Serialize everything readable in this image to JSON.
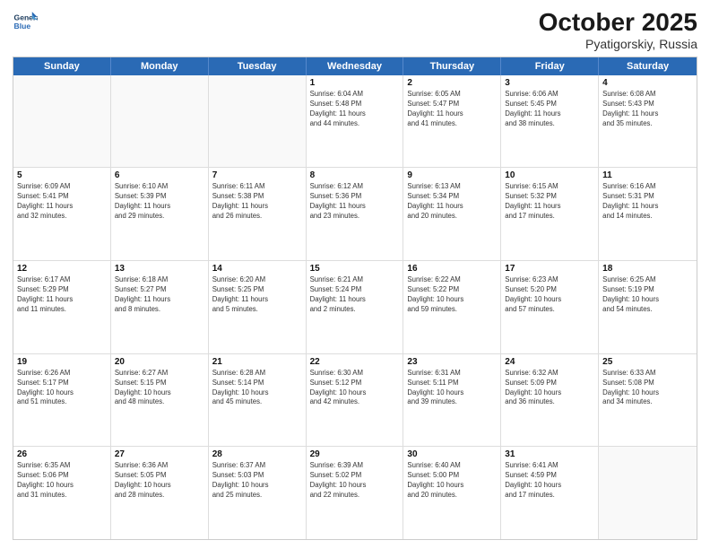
{
  "header": {
    "logo_line1": "General",
    "logo_line2": "Blue",
    "month": "October 2025",
    "location": "Pyatigorskiy, Russia"
  },
  "days_of_week": [
    "Sunday",
    "Monday",
    "Tuesday",
    "Wednesday",
    "Thursday",
    "Friday",
    "Saturday"
  ],
  "weeks": [
    [
      {
        "day": "",
        "info": ""
      },
      {
        "day": "",
        "info": ""
      },
      {
        "day": "",
        "info": ""
      },
      {
        "day": "1",
        "info": "Sunrise: 6:04 AM\nSunset: 5:48 PM\nDaylight: 11 hours\nand 44 minutes."
      },
      {
        "day": "2",
        "info": "Sunrise: 6:05 AM\nSunset: 5:47 PM\nDaylight: 11 hours\nand 41 minutes."
      },
      {
        "day": "3",
        "info": "Sunrise: 6:06 AM\nSunset: 5:45 PM\nDaylight: 11 hours\nand 38 minutes."
      },
      {
        "day": "4",
        "info": "Sunrise: 6:08 AM\nSunset: 5:43 PM\nDaylight: 11 hours\nand 35 minutes."
      }
    ],
    [
      {
        "day": "5",
        "info": "Sunrise: 6:09 AM\nSunset: 5:41 PM\nDaylight: 11 hours\nand 32 minutes."
      },
      {
        "day": "6",
        "info": "Sunrise: 6:10 AM\nSunset: 5:39 PM\nDaylight: 11 hours\nand 29 minutes."
      },
      {
        "day": "7",
        "info": "Sunrise: 6:11 AM\nSunset: 5:38 PM\nDaylight: 11 hours\nand 26 minutes."
      },
      {
        "day": "8",
        "info": "Sunrise: 6:12 AM\nSunset: 5:36 PM\nDaylight: 11 hours\nand 23 minutes."
      },
      {
        "day": "9",
        "info": "Sunrise: 6:13 AM\nSunset: 5:34 PM\nDaylight: 11 hours\nand 20 minutes."
      },
      {
        "day": "10",
        "info": "Sunrise: 6:15 AM\nSunset: 5:32 PM\nDaylight: 11 hours\nand 17 minutes."
      },
      {
        "day": "11",
        "info": "Sunrise: 6:16 AM\nSunset: 5:31 PM\nDaylight: 11 hours\nand 14 minutes."
      }
    ],
    [
      {
        "day": "12",
        "info": "Sunrise: 6:17 AM\nSunset: 5:29 PM\nDaylight: 11 hours\nand 11 minutes."
      },
      {
        "day": "13",
        "info": "Sunrise: 6:18 AM\nSunset: 5:27 PM\nDaylight: 11 hours\nand 8 minutes."
      },
      {
        "day": "14",
        "info": "Sunrise: 6:20 AM\nSunset: 5:25 PM\nDaylight: 11 hours\nand 5 minutes."
      },
      {
        "day": "15",
        "info": "Sunrise: 6:21 AM\nSunset: 5:24 PM\nDaylight: 11 hours\nand 2 minutes."
      },
      {
        "day": "16",
        "info": "Sunrise: 6:22 AM\nSunset: 5:22 PM\nDaylight: 10 hours\nand 59 minutes."
      },
      {
        "day": "17",
        "info": "Sunrise: 6:23 AM\nSunset: 5:20 PM\nDaylight: 10 hours\nand 57 minutes."
      },
      {
        "day": "18",
        "info": "Sunrise: 6:25 AM\nSunset: 5:19 PM\nDaylight: 10 hours\nand 54 minutes."
      }
    ],
    [
      {
        "day": "19",
        "info": "Sunrise: 6:26 AM\nSunset: 5:17 PM\nDaylight: 10 hours\nand 51 minutes."
      },
      {
        "day": "20",
        "info": "Sunrise: 6:27 AM\nSunset: 5:15 PM\nDaylight: 10 hours\nand 48 minutes."
      },
      {
        "day": "21",
        "info": "Sunrise: 6:28 AM\nSunset: 5:14 PM\nDaylight: 10 hours\nand 45 minutes."
      },
      {
        "day": "22",
        "info": "Sunrise: 6:30 AM\nSunset: 5:12 PM\nDaylight: 10 hours\nand 42 minutes."
      },
      {
        "day": "23",
        "info": "Sunrise: 6:31 AM\nSunset: 5:11 PM\nDaylight: 10 hours\nand 39 minutes."
      },
      {
        "day": "24",
        "info": "Sunrise: 6:32 AM\nSunset: 5:09 PM\nDaylight: 10 hours\nand 36 minutes."
      },
      {
        "day": "25",
        "info": "Sunrise: 6:33 AM\nSunset: 5:08 PM\nDaylight: 10 hours\nand 34 minutes."
      }
    ],
    [
      {
        "day": "26",
        "info": "Sunrise: 6:35 AM\nSunset: 5:06 PM\nDaylight: 10 hours\nand 31 minutes."
      },
      {
        "day": "27",
        "info": "Sunrise: 6:36 AM\nSunset: 5:05 PM\nDaylight: 10 hours\nand 28 minutes."
      },
      {
        "day": "28",
        "info": "Sunrise: 6:37 AM\nSunset: 5:03 PM\nDaylight: 10 hours\nand 25 minutes."
      },
      {
        "day": "29",
        "info": "Sunrise: 6:39 AM\nSunset: 5:02 PM\nDaylight: 10 hours\nand 22 minutes."
      },
      {
        "day": "30",
        "info": "Sunrise: 6:40 AM\nSunset: 5:00 PM\nDaylight: 10 hours\nand 20 minutes."
      },
      {
        "day": "31",
        "info": "Sunrise: 6:41 AM\nSunset: 4:59 PM\nDaylight: 10 hours\nand 17 minutes."
      },
      {
        "day": "",
        "info": ""
      }
    ]
  ]
}
